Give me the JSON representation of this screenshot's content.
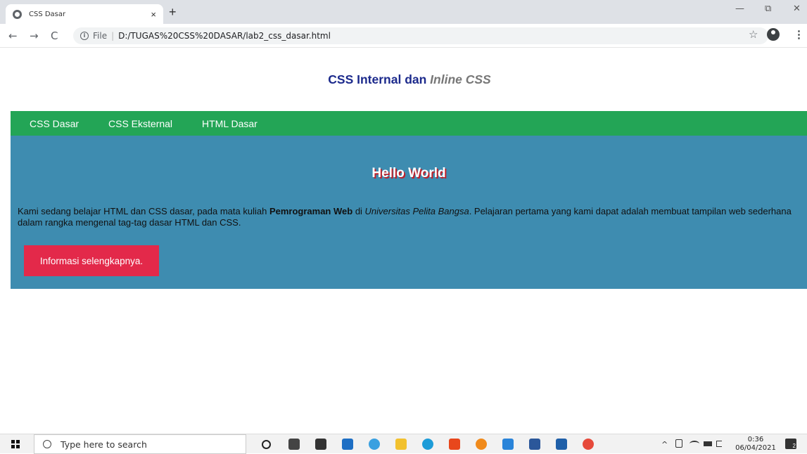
{
  "browser": {
    "tab_title": "CSS Dasar",
    "tab_close": "×",
    "new_tab": "+",
    "back": "←",
    "forward": "→",
    "reload": "C",
    "info": "i",
    "scheme_label": "File",
    "separator": "|",
    "url": "D:/TUGAS%20CSS%20DASAR/lab2_css_dasar.html",
    "star": "☆",
    "menu": "⋮",
    "minimize": "—",
    "maximize": "⧉",
    "close": "✕"
  },
  "page": {
    "heading_main": "CSS Internal dan ",
    "heading_italic": "Inline CSS",
    "nav_items": [
      "CSS Dasar",
      "CSS Eksternal",
      "HTML Dasar"
    ],
    "hero_title": "Hello World",
    "hero_text_1": "Kami sedang belajar HTML dan CSS dasar, pada mata kuliah ",
    "hero_text_bold": "Pemrograman Web",
    "hero_text_2": " di ",
    "hero_text_italic": "Universitas Pelita Bangsa",
    "hero_text_3": ". Pelajaran pertama yang kami dapat adalah membuat tampilan web sederhana dalam rangka mengenal tag-tag dasar HTML dan CSS.",
    "button_label": "Informasi selengkapnya."
  },
  "taskbar": {
    "search_placeholder": "Type here to search",
    "tray_chevron": "^",
    "time": "0:36",
    "date": "06/04/2021",
    "notifications": "2",
    "icons": [
      "cortana-icon",
      "task-view-icon",
      "store-icon",
      "mail-icon",
      "chrome-icon",
      "file-explorer-icon",
      "edge-icon",
      "office-icon",
      "firefox-icon",
      "vscode-icon",
      "word-icon",
      "photos-icon",
      "chrome-icon"
    ],
    "icon_colors": [
      "#222222",
      "#444444",
      "#333333",
      "#1e6fc4",
      "#3aa0e0",
      "#f2c12e",
      "#1d9cd8",
      "#e8471c",
      "#f08a1b",
      "#2a84d9",
      "#2b579a",
      "#1f5fa8",
      "#e64a3b"
    ]
  }
}
